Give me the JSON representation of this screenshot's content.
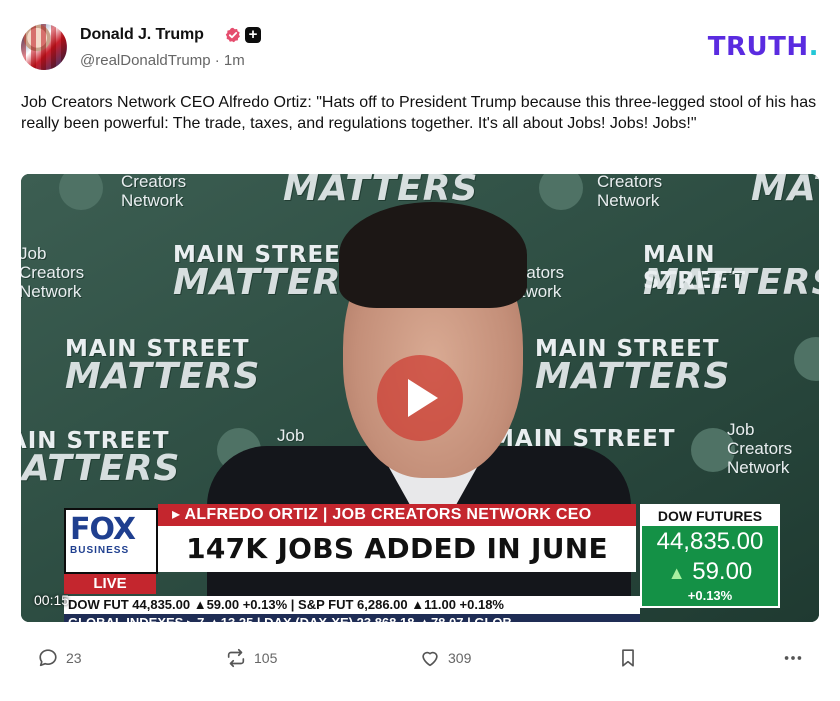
{
  "author": {
    "display_name": "Donald J. Trump",
    "handle": "@realDonaldTrump",
    "time_ago": "· 1m",
    "verified_color": "#e54d6e",
    "plus_badge": "+"
  },
  "brand": {
    "logo_text": "TRUTH",
    "logo_dot": ".",
    "color": "#5a2be0",
    "dot_color": "#22c7d6"
  },
  "post": {
    "text": "Job Creators Network CEO Alfredo Ortiz: \"Hats off to President Trump because this three-legged stool of his has really been powerful: The trade, taxes, and regulations together. It's all about Jobs! Jobs! Jobs!\""
  },
  "video": {
    "timestamp": "00:15",
    "background_text": {
      "main_street": "MAIN STREET",
      "matters": "MATTERS",
      "job": "Job",
      "creators": "Creators",
      "network": "Network"
    },
    "lower_third": {
      "network_logo": "FOX",
      "network_logo_sub": "BUSINESS",
      "live_label": "LIVE",
      "speaker_banner": "▸ ALFREDO ORTIZ | JOB CREATORS NETWORK CEO",
      "headline": "147K JOBS ADDED IN JUNE",
      "dow_label": "DOW FUTURES",
      "dow_value": "44,835.00",
      "dow_change": "59.00",
      "dow_pct": "+0.13%",
      "ticker_line_1": "DOW FUT 44,835.00 ▲59.00 +0.13% | S&P FUT 6,286.00 ▲11.00 +0.18%",
      "ticker_line_2": "GLOBAL INDEXES ▸ 7 ▲13.25 | DAX (DAX-XE) 23,868.18 ▲78.07 | GLOB"
    }
  },
  "actions": {
    "replies": "23",
    "retruths": "105",
    "likes": "309"
  }
}
